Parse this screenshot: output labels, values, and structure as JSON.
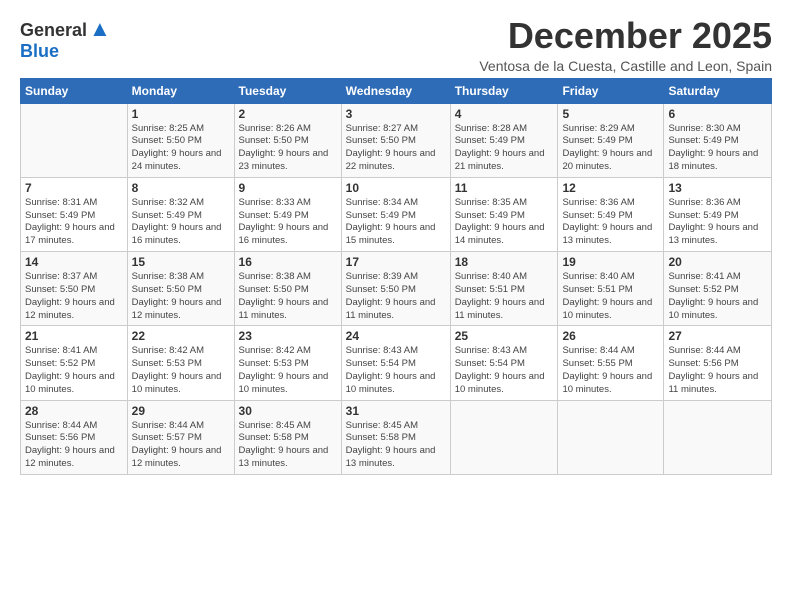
{
  "logo": {
    "general": "General",
    "blue": "Blue"
  },
  "title": "December 2025",
  "subtitle": "Ventosa de la Cuesta, Castille and Leon, Spain",
  "days_of_week": [
    "Sunday",
    "Monday",
    "Tuesday",
    "Wednesday",
    "Thursday",
    "Friday",
    "Saturday"
  ],
  "weeks": [
    [
      {
        "day": "",
        "sunrise": "",
        "sunset": "",
        "daylight": ""
      },
      {
        "day": "1",
        "sunrise": "Sunrise: 8:25 AM",
        "sunset": "Sunset: 5:50 PM",
        "daylight": "Daylight: 9 hours and 24 minutes."
      },
      {
        "day": "2",
        "sunrise": "Sunrise: 8:26 AM",
        "sunset": "Sunset: 5:50 PM",
        "daylight": "Daylight: 9 hours and 23 minutes."
      },
      {
        "day": "3",
        "sunrise": "Sunrise: 8:27 AM",
        "sunset": "Sunset: 5:50 PM",
        "daylight": "Daylight: 9 hours and 22 minutes."
      },
      {
        "day": "4",
        "sunrise": "Sunrise: 8:28 AM",
        "sunset": "Sunset: 5:49 PM",
        "daylight": "Daylight: 9 hours and 21 minutes."
      },
      {
        "day": "5",
        "sunrise": "Sunrise: 8:29 AM",
        "sunset": "Sunset: 5:49 PM",
        "daylight": "Daylight: 9 hours and 20 minutes."
      },
      {
        "day": "6",
        "sunrise": "Sunrise: 8:30 AM",
        "sunset": "Sunset: 5:49 PM",
        "daylight": "Daylight: 9 hours and 18 minutes."
      }
    ],
    [
      {
        "day": "7",
        "sunrise": "Sunrise: 8:31 AM",
        "sunset": "Sunset: 5:49 PM",
        "daylight": "Daylight: 9 hours and 17 minutes."
      },
      {
        "day": "8",
        "sunrise": "Sunrise: 8:32 AM",
        "sunset": "Sunset: 5:49 PM",
        "daylight": "Daylight: 9 hours and 16 minutes."
      },
      {
        "day": "9",
        "sunrise": "Sunrise: 8:33 AM",
        "sunset": "Sunset: 5:49 PM",
        "daylight": "Daylight: 9 hours and 16 minutes."
      },
      {
        "day": "10",
        "sunrise": "Sunrise: 8:34 AM",
        "sunset": "Sunset: 5:49 PM",
        "daylight": "Daylight: 9 hours and 15 minutes."
      },
      {
        "day": "11",
        "sunrise": "Sunrise: 8:35 AM",
        "sunset": "Sunset: 5:49 PM",
        "daylight": "Daylight: 9 hours and 14 minutes."
      },
      {
        "day": "12",
        "sunrise": "Sunrise: 8:36 AM",
        "sunset": "Sunset: 5:49 PM",
        "daylight": "Daylight: 9 hours and 13 minutes."
      },
      {
        "day": "13",
        "sunrise": "Sunrise: 8:36 AM",
        "sunset": "Sunset: 5:49 PM",
        "daylight": "Daylight: 9 hours and 13 minutes."
      }
    ],
    [
      {
        "day": "14",
        "sunrise": "Sunrise: 8:37 AM",
        "sunset": "Sunset: 5:50 PM",
        "daylight": "Daylight: 9 hours and 12 minutes."
      },
      {
        "day": "15",
        "sunrise": "Sunrise: 8:38 AM",
        "sunset": "Sunset: 5:50 PM",
        "daylight": "Daylight: 9 hours and 12 minutes."
      },
      {
        "day": "16",
        "sunrise": "Sunrise: 8:38 AM",
        "sunset": "Sunset: 5:50 PM",
        "daylight": "Daylight: 9 hours and 11 minutes."
      },
      {
        "day": "17",
        "sunrise": "Sunrise: 8:39 AM",
        "sunset": "Sunset: 5:50 PM",
        "daylight": "Daylight: 9 hours and 11 minutes."
      },
      {
        "day": "18",
        "sunrise": "Sunrise: 8:40 AM",
        "sunset": "Sunset: 5:51 PM",
        "daylight": "Daylight: 9 hours and 11 minutes."
      },
      {
        "day": "19",
        "sunrise": "Sunrise: 8:40 AM",
        "sunset": "Sunset: 5:51 PM",
        "daylight": "Daylight: 9 hours and 10 minutes."
      },
      {
        "day": "20",
        "sunrise": "Sunrise: 8:41 AM",
        "sunset": "Sunset: 5:52 PM",
        "daylight": "Daylight: 9 hours and 10 minutes."
      }
    ],
    [
      {
        "day": "21",
        "sunrise": "Sunrise: 8:41 AM",
        "sunset": "Sunset: 5:52 PM",
        "daylight": "Daylight: 9 hours and 10 minutes."
      },
      {
        "day": "22",
        "sunrise": "Sunrise: 8:42 AM",
        "sunset": "Sunset: 5:53 PM",
        "daylight": "Daylight: 9 hours and 10 minutes."
      },
      {
        "day": "23",
        "sunrise": "Sunrise: 8:42 AM",
        "sunset": "Sunset: 5:53 PM",
        "daylight": "Daylight: 9 hours and 10 minutes."
      },
      {
        "day": "24",
        "sunrise": "Sunrise: 8:43 AM",
        "sunset": "Sunset: 5:54 PM",
        "daylight": "Daylight: 9 hours and 10 minutes."
      },
      {
        "day": "25",
        "sunrise": "Sunrise: 8:43 AM",
        "sunset": "Sunset: 5:54 PM",
        "daylight": "Daylight: 9 hours and 10 minutes."
      },
      {
        "day": "26",
        "sunrise": "Sunrise: 8:44 AM",
        "sunset": "Sunset: 5:55 PM",
        "daylight": "Daylight: 9 hours and 10 minutes."
      },
      {
        "day": "27",
        "sunrise": "Sunrise: 8:44 AM",
        "sunset": "Sunset: 5:56 PM",
        "daylight": "Daylight: 9 hours and 11 minutes."
      }
    ],
    [
      {
        "day": "28",
        "sunrise": "Sunrise: 8:44 AM",
        "sunset": "Sunset: 5:56 PM",
        "daylight": "Daylight: 9 hours and 12 minutes."
      },
      {
        "day": "29",
        "sunrise": "Sunrise: 8:44 AM",
        "sunset": "Sunset: 5:57 PM",
        "daylight": "Daylight: 9 hours and 12 minutes."
      },
      {
        "day": "30",
        "sunrise": "Sunrise: 8:45 AM",
        "sunset": "Sunset: 5:58 PM",
        "daylight": "Daylight: 9 hours and 13 minutes."
      },
      {
        "day": "31",
        "sunrise": "Sunrise: 8:45 AM",
        "sunset": "Sunset: 5:58 PM",
        "daylight": "Daylight: 9 hours and 13 minutes."
      },
      {
        "day": "",
        "sunrise": "",
        "sunset": "",
        "daylight": ""
      },
      {
        "day": "",
        "sunrise": "",
        "sunset": "",
        "daylight": ""
      },
      {
        "day": "",
        "sunrise": "",
        "sunset": "",
        "daylight": ""
      }
    ]
  ]
}
